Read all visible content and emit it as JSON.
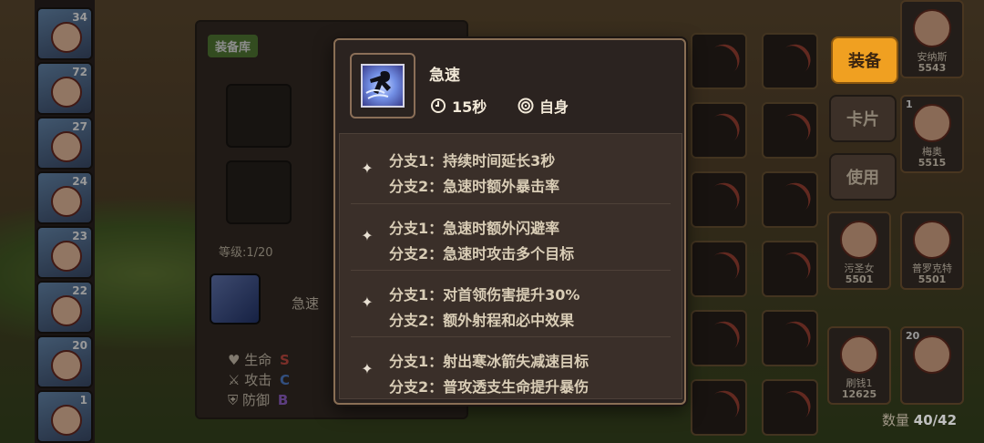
{
  "roster": {
    "levels": [
      "34",
      "72",
      "27",
      "24",
      "23",
      "22",
      "20",
      "1"
    ]
  },
  "equip_panel": {
    "tag": "装备库",
    "level_label": "等级:1/20",
    "skill_name": "急速",
    "stats": [
      {
        "label": "生命",
        "grade": "S",
        "color": "#e0564a"
      },
      {
        "label": "攻击",
        "grade": "C",
        "color": "#5a8fe6"
      },
      {
        "label": "防御",
        "grade": "B",
        "color": "#a76ee6"
      }
    ]
  },
  "right_panel": {
    "equip_button": "装备",
    "card_button": "卡片",
    "use_button": "使用",
    "heroes": [
      {
        "name": "安纳斯",
        "power": "5543",
        "level": ""
      },
      {
        "name": "梅奥",
        "power": "5515",
        "level": "1"
      },
      {
        "name": "污圣女",
        "power": "5501",
        "level": ""
      },
      {
        "name": "普罗克特",
        "power": "5501",
        "level": ""
      },
      {
        "name": "刷钱1",
        "power": "12625",
        "level": ""
      },
      {
        "name": "",
        "power": "",
        "level": "20"
      }
    ],
    "count_label": "数量",
    "count_value": "40/42"
  },
  "tooltip": {
    "title": "急速",
    "duration": "15秒",
    "target": "自身",
    "icon_names": {
      "duration": "clock-icon",
      "target": "target-icon"
    },
    "branches": [
      {
        "line1": "分支1：持续时间延长3秒",
        "line2": "分支2：急速时额外暴击率"
      },
      {
        "line1": "分支1：急速时额外闪避率",
        "line2": "分支2：急速时攻击多个目标"
      },
      {
        "line1": "分支1：对首领伤害提升30%",
        "line2": "分支2：额外射程和必中效果"
      },
      {
        "line1": "分支1：射出寒冰箭失减速目标",
        "line2": "分支2：普攻透支生命提升暴伤"
      }
    ]
  },
  "colors": {
    "accent_orange": "#f0a021",
    "panel_dark": "#2b2320",
    "tag_green": "#5d8b3a"
  }
}
